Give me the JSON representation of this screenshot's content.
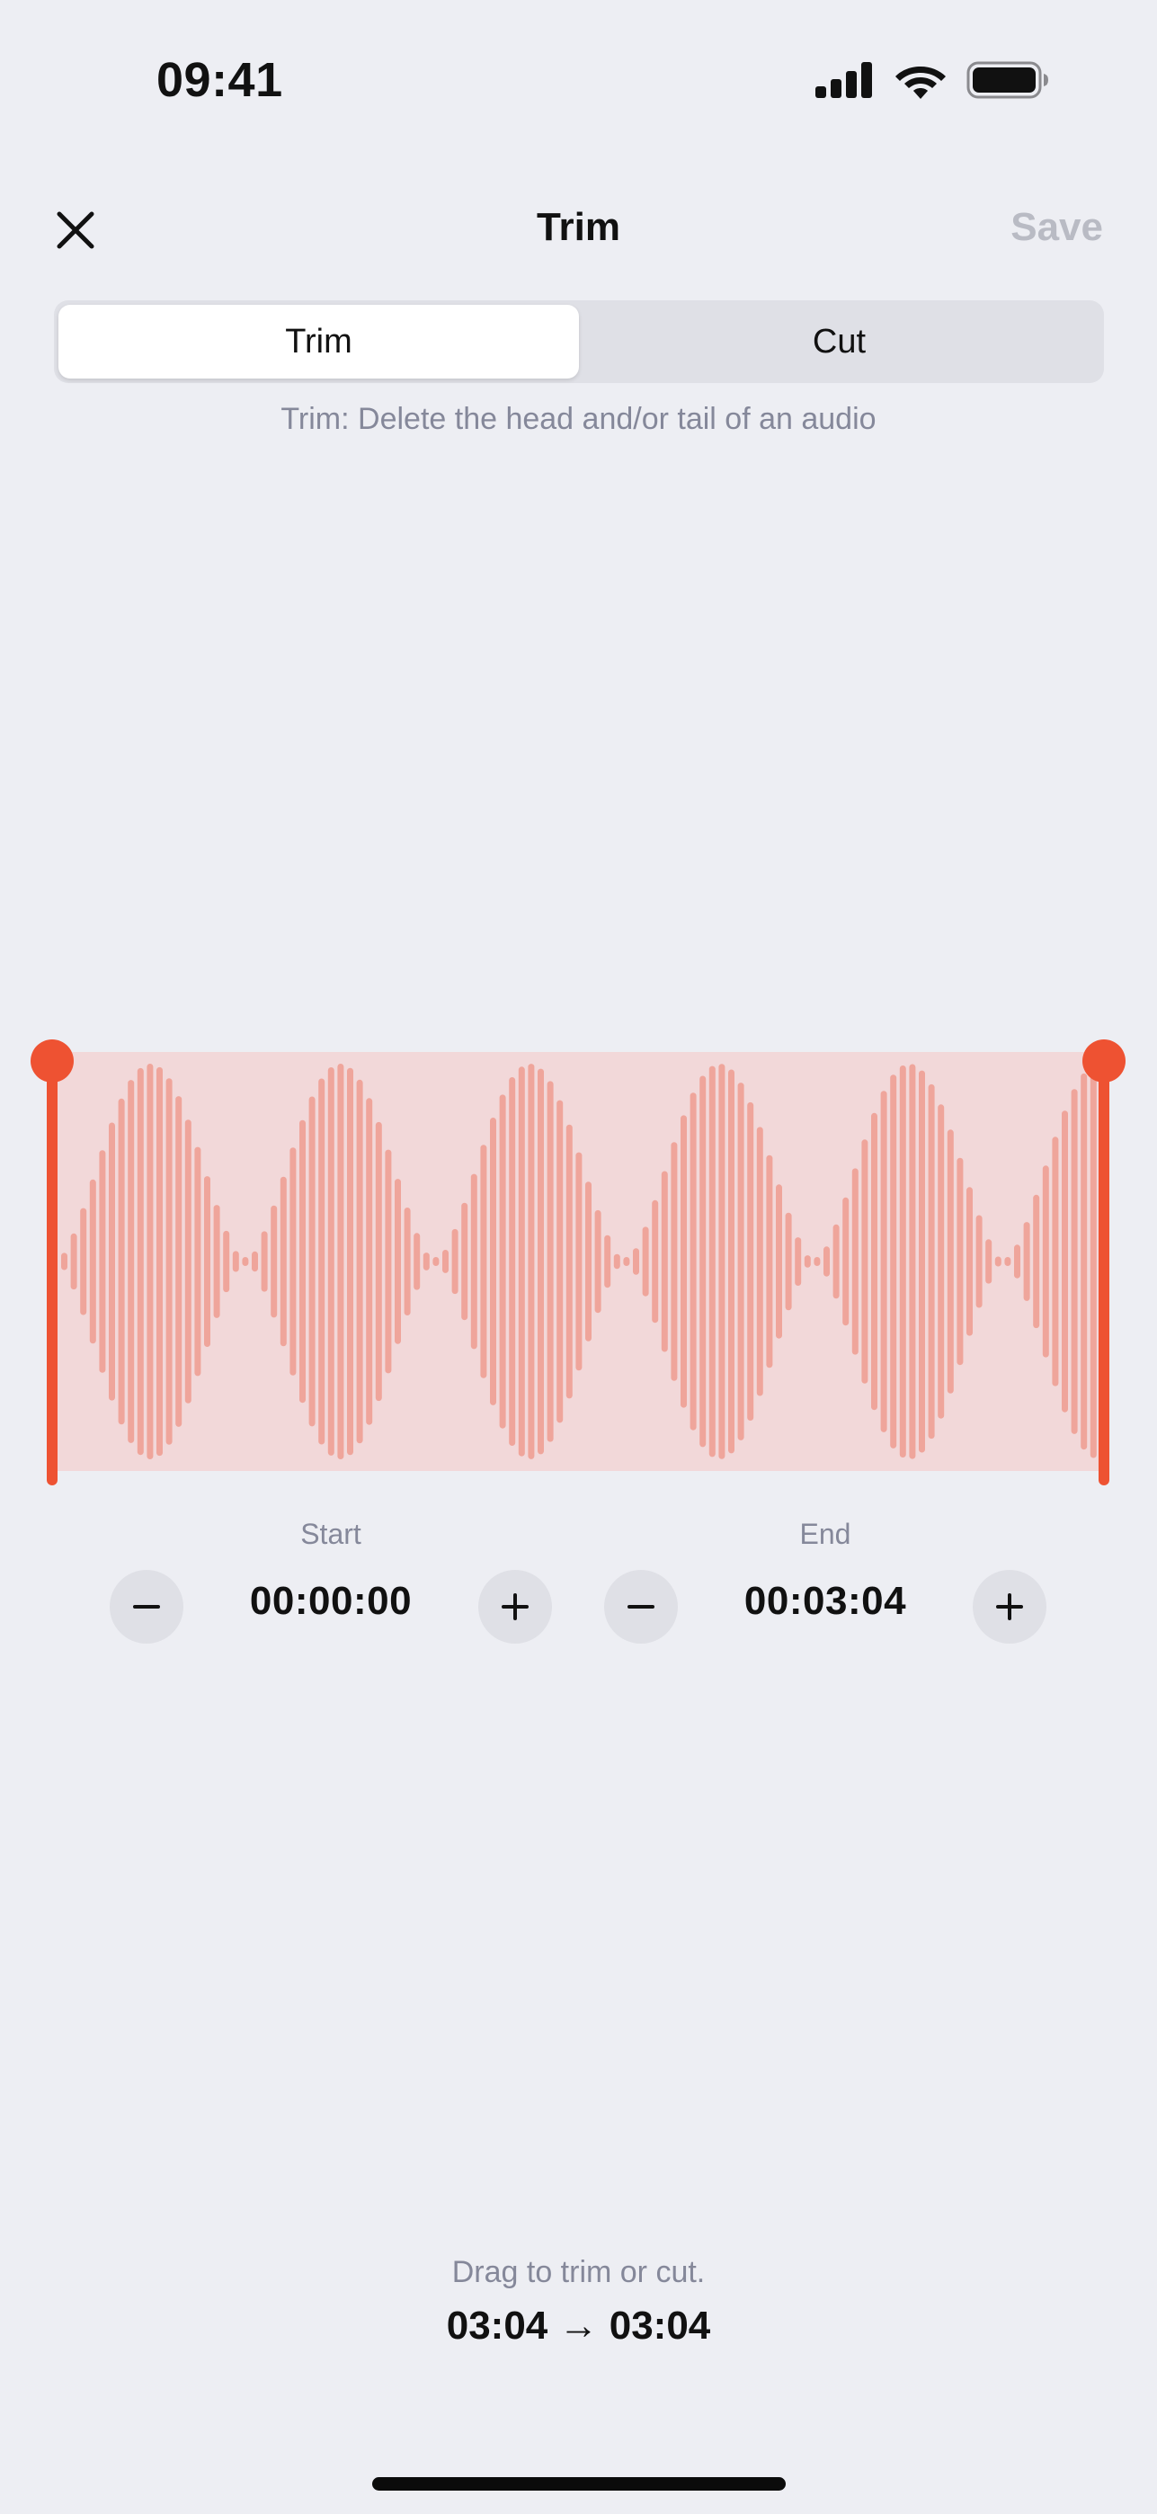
{
  "status_bar": {
    "time": "09:41",
    "icons": [
      "cellular-signal-icon",
      "wifi-icon",
      "battery-icon"
    ]
  },
  "nav": {
    "close_icon": "close-icon",
    "title": "Trim",
    "save_label": "Save"
  },
  "mode_selector": {
    "options": [
      {
        "label": "Trim",
        "selected": true
      },
      {
        "label": "Cut",
        "selected": false
      }
    ],
    "description": "Trim: Delete the head and/or tail of an audio"
  },
  "waveform": {
    "selection_start_fraction": 0.0,
    "selection_end_fraction": 1.0
  },
  "start": {
    "label": "Start",
    "value": "00:00:00"
  },
  "end": {
    "label": "End",
    "value": "00:03:04"
  },
  "footer": {
    "hint": "Drag to trim or cut.",
    "duration": "03:04 → 03:04"
  },
  "colors": {
    "accent": "#EE5232",
    "selection_fill": "#F2D8D9",
    "waveform_bar": "#EFA59B",
    "background": "#EDEEF3",
    "muted_text": "#85889A",
    "disabled_text": "#B9BBC4"
  }
}
